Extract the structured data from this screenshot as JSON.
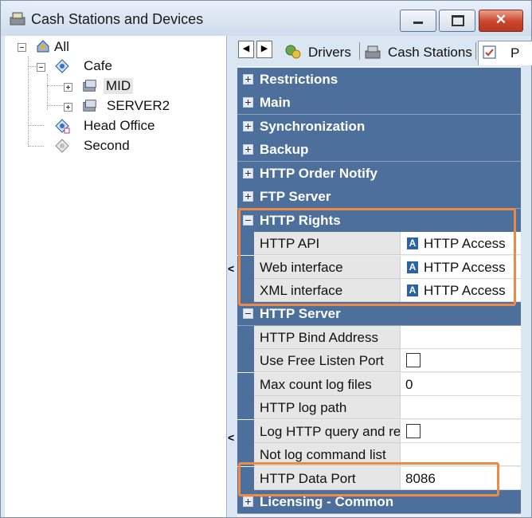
{
  "window": {
    "title": "Cash Stations and Devices",
    "close_glyph": "✕"
  },
  "tree": {
    "nodes": [
      {
        "label": "All",
        "icon": "network-icon"
      },
      {
        "label": "Cafe",
        "icon": "station-group-icon"
      },
      {
        "label": "MID",
        "icon": "server-icon"
      },
      {
        "label": "SERVER2",
        "icon": "server-icon"
      },
      {
        "label": "Head Office",
        "icon": "station-group-icon"
      },
      {
        "label": "Second",
        "icon": "station-group-icon"
      }
    ]
  },
  "splitter": {
    "arrow": "<"
  },
  "tabs": {
    "scroll_left": "◀",
    "scroll_right": "▶",
    "items": [
      {
        "label": "Drivers",
        "icon": "drivers-icon"
      },
      {
        "label": "Cash Stations",
        "icon": "cash-station-icon"
      },
      {
        "label": "P",
        "icon": "properties-icon"
      }
    ]
  },
  "properties": {
    "categories": {
      "restrictions": "Restrictions",
      "main": "Main",
      "synchronization": "Synchronization",
      "backup": "Backup",
      "http_order_notify": "HTTP Order Notify",
      "ftp_server": "FTP Server",
      "http_rights": "HTTP Rights",
      "http_server": "HTTP Server",
      "licensing_common": "Licensing - Common"
    },
    "http_rights": [
      {
        "name": "HTTP API",
        "value": "HTTP Access"
      },
      {
        "name": "Web interface",
        "value": "HTTP Access"
      },
      {
        "name": "XML interface",
        "value": "HTTP Access"
      }
    ],
    "http_server": [
      {
        "name": "HTTP Bind Address",
        "value": ""
      },
      {
        "name": "Use Free Listen Port",
        "value": "",
        "checked": false
      },
      {
        "name": "Max count log files",
        "value": "0"
      },
      {
        "name": "HTTP log path",
        "value": ""
      },
      {
        "name": "Log HTTP query and re",
        "value": "",
        "checked": false
      },
      {
        "name": "Not log command list",
        "value": ""
      },
      {
        "name": "HTTP Data Port",
        "value": "8086"
      }
    ],
    "enum_icon_letter": "A"
  },
  "colors": {
    "category_header": "#4d6f9b",
    "highlight": "#ee8a45"
  }
}
